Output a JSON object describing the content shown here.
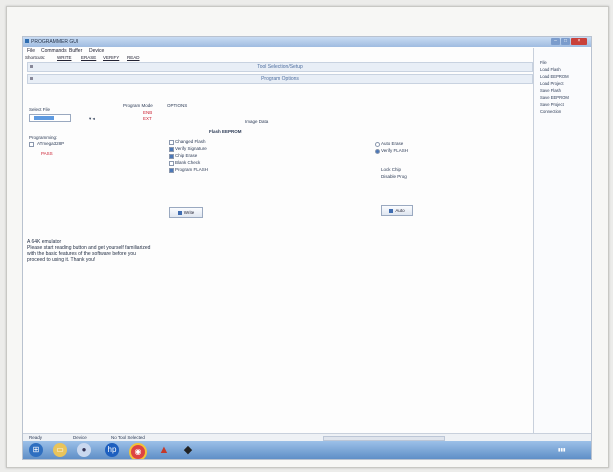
{
  "window": {
    "title": "PROGRAMMER GUI"
  },
  "menu": [
    "File",
    "Commands",
    "Buffer",
    "Device"
  ],
  "shortcuts": {
    "label": "Shortcuts:",
    "items": [
      "WRITE",
      "ERASE",
      "VERIFY",
      "READ"
    ]
  },
  "section_bars": [
    "Tool Selection/Setup",
    "Program Options"
  ],
  "sidebar": {
    "items": [
      "File",
      "Load Flash",
      "Load EEPROM",
      "Load Project",
      "Save Flash",
      "Save EEPROM",
      "Save Project",
      "Connection"
    ]
  },
  "left": {
    "select_file_label": "Select File",
    "program_mode_label": "Program Mode",
    "options_label": "OPTIONS",
    "programming_label": "Programming:",
    "chip_label": "ATmega328P",
    "red_values": [
      "ENB",
      "EXT"
    ],
    "red_status": "PASS"
  },
  "center": {
    "image_data_label": "Image Data",
    "panel_title": "Flash EEPROM",
    "checkboxes": [
      {
        "label": "Changed Flash",
        "checked": false
      },
      {
        "label": "Verify Signature",
        "checked": true
      },
      {
        "label": "Chip Erase",
        "checked": true
      },
      {
        "label": "Blank Check",
        "checked": false
      },
      {
        "label": "Program FLASH",
        "checked": true
      }
    ],
    "write_button": "Write"
  },
  "right": {
    "radios": [
      {
        "label": "Auto Erase",
        "checked": false
      },
      {
        "label": "Verify FLASH",
        "checked": true
      }
    ],
    "labels": [
      "Lock Chip",
      "Disable Prog"
    ],
    "go_button": "Auto"
  },
  "log_lines": [
    "A 64K emulator",
    "Please start reading button and get yourself familiarized",
    "with the basic features of the software before you",
    "proceed to using it. Thank you!"
  ],
  "statusbar": [
    "Ready",
    "Device",
    "No Tool Selected"
  ],
  "taskbar": {
    "icons": [
      "windows-start",
      "folder",
      "media",
      "hp",
      "chrome",
      "matlab",
      "app"
    ]
  },
  "colors": {
    "titlebar": "#9fbbe0",
    "taskbar": "#5f8fc7",
    "accent": "#4b78b8",
    "error": "#c23",
    "close": "#c9413a"
  }
}
